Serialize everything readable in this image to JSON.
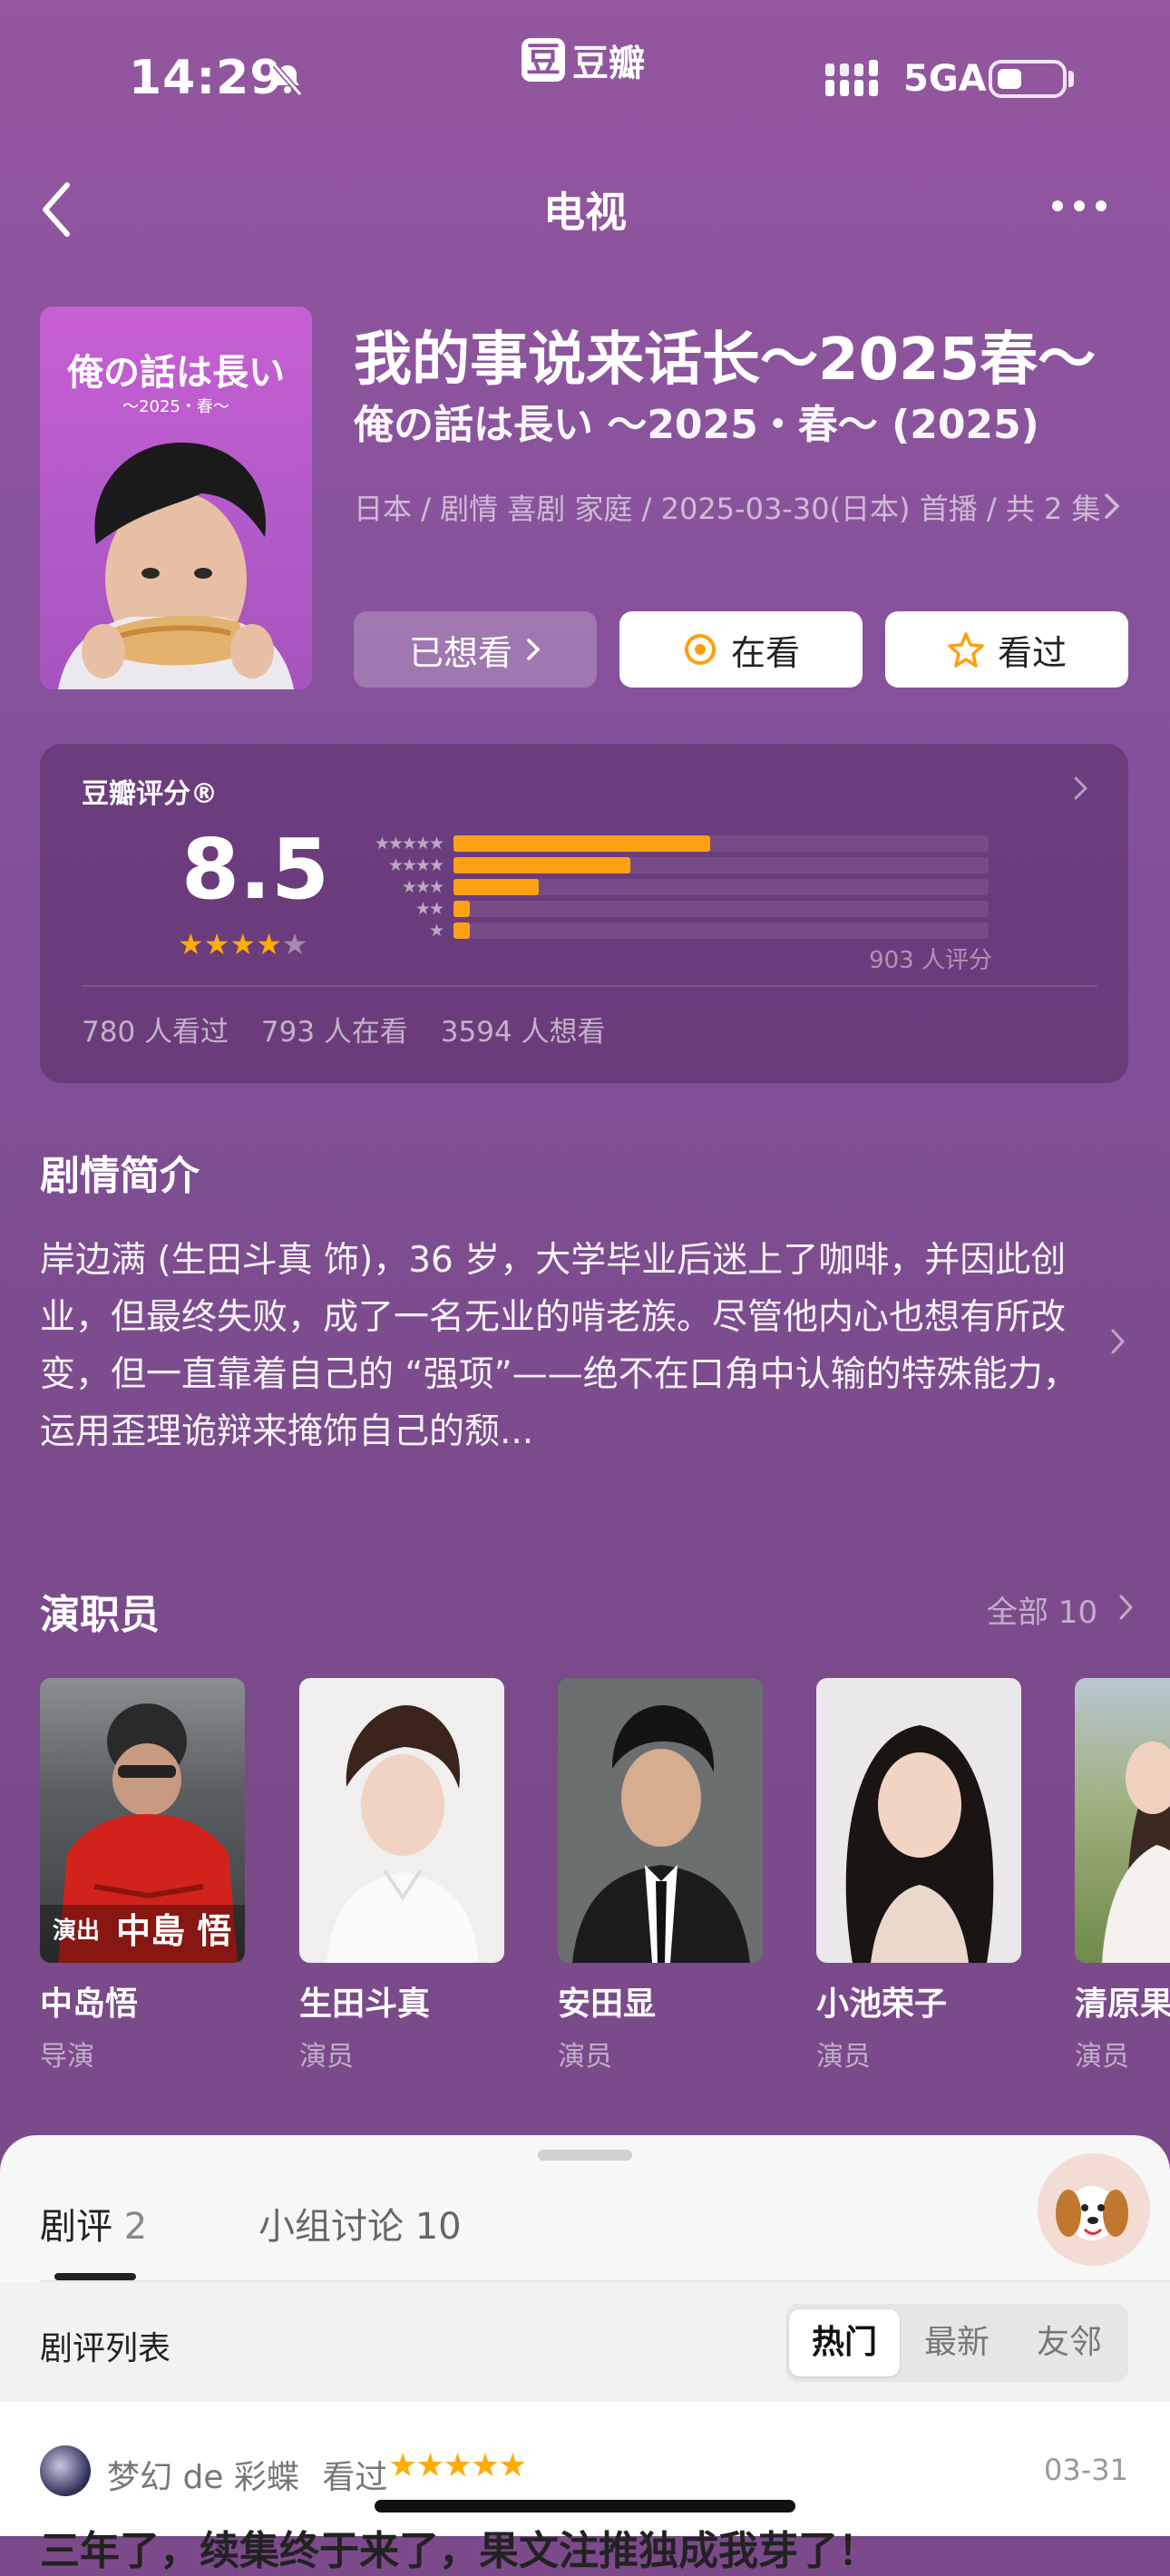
{
  "status_bar": {
    "time": "14:29",
    "app_logo": "豆",
    "app_name": "豆瓣",
    "network": "5GA"
  },
  "nav": {
    "title": "电视"
  },
  "poster": {
    "title": "俺の話は長い",
    "subtitle": "～2025・春～"
  },
  "header": {
    "title": "我的事说来话长～2025春～",
    "original_title": "俺の話は長い ～2025・春～ (2025)",
    "meta": "日本 / 剧情 喜剧 家庭 / 2025-03-30(日本) 首播 / 共 2 集"
  },
  "actions": {
    "wish": "已想看",
    "watching": "在看",
    "watched": "看过"
  },
  "rating": {
    "label": "豆瓣评分®",
    "score": "8.5",
    "stars_value": 4.25,
    "distribution": [
      {
        "stars": "★★★★★",
        "fraction": 0.48
      },
      {
        "stars": "★★★★",
        "fraction": 0.33
      },
      {
        "stars": "★★★",
        "fraction": 0.16
      },
      {
        "stars": "★★",
        "fraction": 0.03
      },
      {
        "stars": "★",
        "fraction": 0.03
      }
    ],
    "votes": "903 人评分",
    "watched": "780 人看过",
    "watching": "793 人在看",
    "wish": "3594 人想看"
  },
  "synopsis": {
    "title": "剧情简介",
    "text": "岸边满 (生田斗真 饰)，36 岁，大学毕业后迷上了咖啡，并因此创业，但最终失败，成了一名无业的啃老族。尽管他内心也想有所改变，但一直靠着自己的 “强项”——绝不在口角中认输的特殊能力，运用歪理诡辩来掩饰自己的颓..."
  },
  "cast": {
    "title": "演职员",
    "all_label": "全部 10",
    "members": [
      {
        "name": "中岛悟",
        "role": "导演",
        "photo_caption_small": "演出",
        "photo_caption_big": "中島 悟"
      },
      {
        "name": "生田斗真",
        "role": "演员"
      },
      {
        "name": "安田显",
        "role": "演员"
      },
      {
        "name": "小池荣子",
        "role": "演员"
      },
      {
        "name": "清原果",
        "role": "演员"
      }
    ]
  },
  "sheet": {
    "tab_reviews": "剧评",
    "tab_reviews_count": "2",
    "tab_groups": "小组讨论",
    "tab_groups_count": "10",
    "list_title": "剧评列表",
    "sort_hot": "热门",
    "sort_new": "最新",
    "sort_friends": "友邻",
    "review": {
      "user": "梦幻 de 彩蝶",
      "status": "看过",
      "stars": "★★★★★",
      "date": "03-31",
      "title": "三年了，续集终于来了，果文注推独成我芽了！"
    }
  },
  "colors": {
    "accent_orange": "#ffa114",
    "background": "#8a4f97"
  }
}
